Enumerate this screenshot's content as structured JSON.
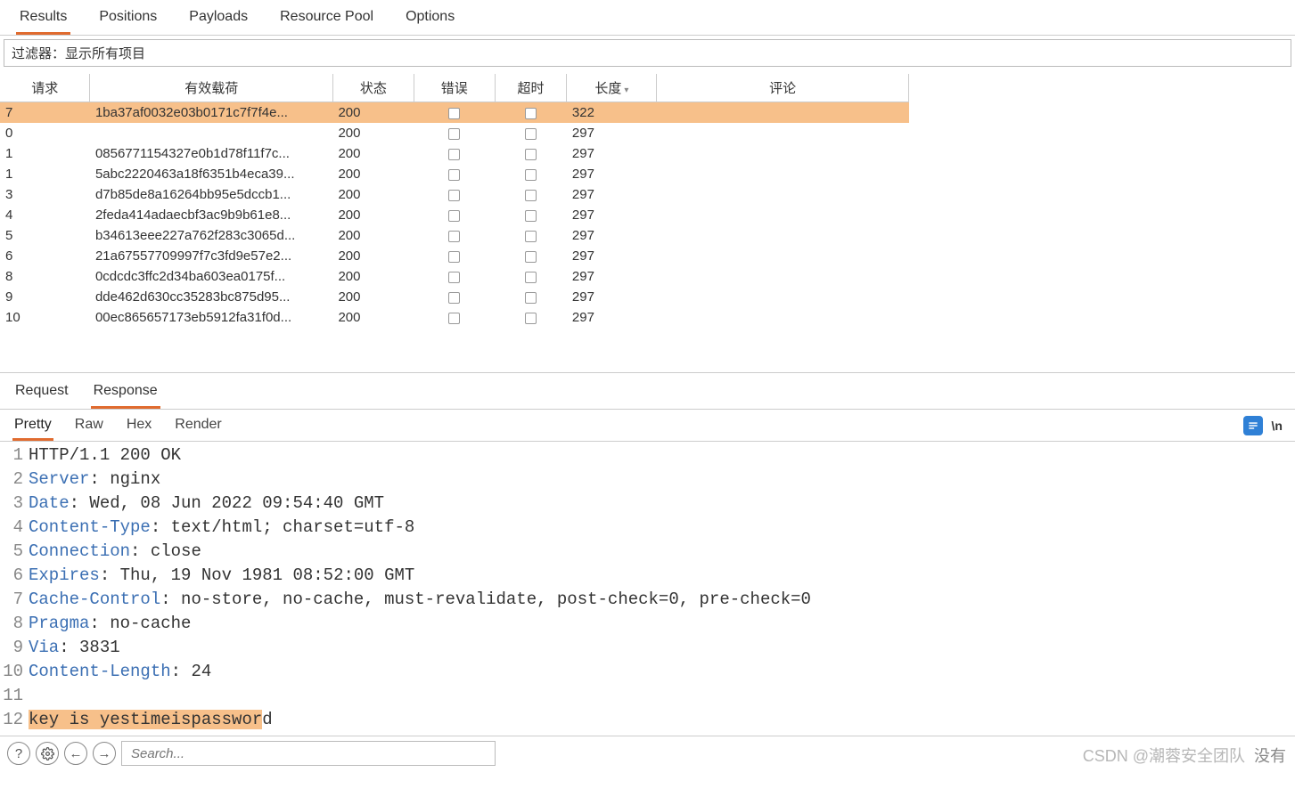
{
  "top_tabs": {
    "items": [
      {
        "label": "Results",
        "active": true
      },
      {
        "label": "Positions",
        "active": false
      },
      {
        "label": "Payloads",
        "active": false
      },
      {
        "label": "Resource Pool",
        "active": false
      },
      {
        "label": "Options",
        "active": false
      }
    ]
  },
  "filter": {
    "text": "过滤器：显示所有项目"
  },
  "table": {
    "headers": {
      "request": "请求",
      "payload": "有效载荷",
      "status": "状态",
      "error": "错误",
      "timeout": "超时",
      "length": "长度",
      "comment": "评论"
    },
    "sorted_column": "length",
    "rows": [
      {
        "request": "7",
        "payload": "1ba37af0032e03b0171c7f7f4e...",
        "status": "200",
        "error": false,
        "timeout": false,
        "length": "322",
        "selected": true
      },
      {
        "request": "0",
        "payload": "",
        "status": "200",
        "error": false,
        "timeout": false,
        "length": "297",
        "selected": false
      },
      {
        "request": "1",
        "payload": "0856771154327e0b1d78f11f7c...",
        "status": "200",
        "error": false,
        "timeout": false,
        "length": "297",
        "selected": false
      },
      {
        "request": "1",
        "payload": "5abc2220463a18f6351b4eca39...",
        "status": "200",
        "error": false,
        "timeout": false,
        "length": "297",
        "selected": false
      },
      {
        "request": "3",
        "payload": "d7b85de8a16264bb95e5dccb1...",
        "status": "200",
        "error": false,
        "timeout": false,
        "length": "297",
        "selected": false
      },
      {
        "request": "4",
        "payload": "2feda414adaecbf3ac9b9b61e8...",
        "status": "200",
        "error": false,
        "timeout": false,
        "length": "297",
        "selected": false
      },
      {
        "request": "5",
        "payload": "b34613eee227a762f283c3065d...",
        "status": "200",
        "error": false,
        "timeout": false,
        "length": "297",
        "selected": false
      },
      {
        "request": "6",
        "payload": "21a67557709997f7c3fd9e57e2...",
        "status": "200",
        "error": false,
        "timeout": false,
        "length": "297",
        "selected": false
      },
      {
        "request": "8",
        "payload": "0cdcdc3ffc2d34ba603ea0175f...",
        "status": "200",
        "error": false,
        "timeout": false,
        "length": "297",
        "selected": false
      },
      {
        "request": "9",
        "payload": "dde462d630cc35283bc875d95...",
        "status": "200",
        "error": false,
        "timeout": false,
        "length": "297",
        "selected": false
      },
      {
        "request": "10",
        "payload": "00ec865657173eb5912fa31f0d...",
        "status": "200",
        "error": false,
        "timeout": false,
        "length": "297",
        "selected": false
      }
    ]
  },
  "rr_tabs": {
    "items": [
      {
        "label": "Request",
        "active": false
      },
      {
        "label": "Response",
        "active": true
      }
    ]
  },
  "view_tabs": {
    "items": [
      {
        "label": "Pretty",
        "active": true
      },
      {
        "label": "Raw",
        "active": false
      },
      {
        "label": "Hex",
        "active": false
      },
      {
        "label": "Render",
        "active": false
      }
    ],
    "newline": "\\n"
  },
  "response_lines": [
    {
      "n": "1",
      "plain": "HTTP/1.1 200 OK"
    },
    {
      "n": "2",
      "key": "Server",
      "rest": ": nginx"
    },
    {
      "n": "3",
      "key": "Date",
      "rest": ": Wed, 08 Jun 2022 09:54:40 GMT"
    },
    {
      "n": "4",
      "key": "Content-Type",
      "rest": ": text/html; charset=utf-8"
    },
    {
      "n": "5",
      "key": "Connection",
      "rest": ": close"
    },
    {
      "n": "6",
      "key": "Expires",
      "rest": ": Thu, 19 Nov 1981 08:52:00 GMT"
    },
    {
      "n": "7",
      "key": "Cache-Control",
      "rest": ": no-store, no-cache, must-revalidate, post-check=0, pre-check=0"
    },
    {
      "n": "8",
      "key": "Pragma",
      "rest": ": no-cache"
    },
    {
      "n": "9",
      "key": "Via",
      "rest": ": 3831"
    },
    {
      "n": "10",
      "key": "Content-Length",
      "rest": ": 24"
    },
    {
      "n": "11",
      "plain": ""
    },
    {
      "n": "12",
      "hl": "key is yestimeispasswor",
      "tail": "d"
    }
  ],
  "footer": {
    "search_placeholder": "Search...",
    "watermark": "CSDN @潮蓉安全团队",
    "right_text": "没有"
  }
}
